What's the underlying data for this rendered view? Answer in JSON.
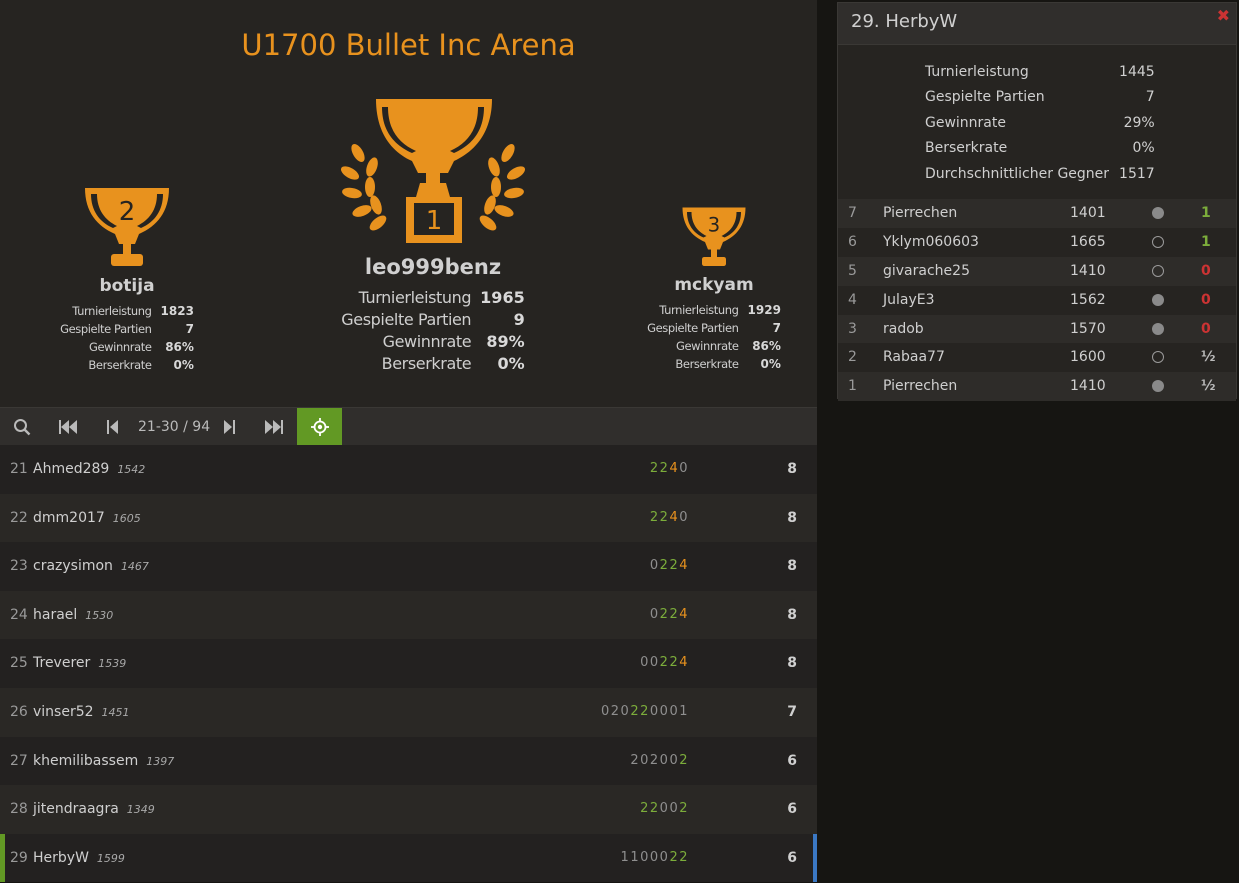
{
  "tournament": {
    "title": "U1700 Bullet Inc Arena",
    "podium": {
      "first": {
        "name": "leo999benz",
        "rank": "1",
        "performance": "1965",
        "games": "9",
        "win_rate": "89%",
        "berserk_rate": "0%"
      },
      "second": {
        "name": "botija",
        "rank": "2",
        "performance": "1823",
        "games": "7",
        "win_rate": "86%",
        "berserk_rate": "0%"
      },
      "third": {
        "name": "mckyam",
        "rank": "3",
        "performance": "1929",
        "games": "7",
        "win_rate": "86%",
        "berserk_rate": "0%"
      }
    },
    "labels": {
      "performance": "Turnierleistung",
      "games": "Gespielte Partien",
      "win_rate": "Gewinnrate",
      "berserk_rate": "Berserkrate",
      "avg_opponent": "Durchschnittlicher Gegner"
    },
    "pager": {
      "status": "21-30 / 94"
    },
    "standings": [
      {
        "rank": "21",
        "name": "Ahmed289",
        "rating": "1542",
        "sheet": [
          [
            "2",
            "g"
          ],
          [
            "2",
            "g"
          ],
          [
            "4",
            "o"
          ],
          [
            "0",
            "n"
          ]
        ],
        "total": "8"
      },
      {
        "rank": "22",
        "name": "dmm2017",
        "rating": "1605",
        "sheet": [
          [
            "2",
            "g"
          ],
          [
            "2",
            "g"
          ],
          [
            "4",
            "o"
          ],
          [
            "0",
            "n"
          ]
        ],
        "total": "8"
      },
      {
        "rank": "23",
        "name": "crazysimon",
        "rating": "1467",
        "sheet": [
          [
            "0",
            "n"
          ],
          [
            "2",
            "g"
          ],
          [
            "2",
            "g"
          ],
          [
            "4",
            "o"
          ]
        ],
        "total": "8"
      },
      {
        "rank": "24",
        "name": "harael",
        "rating": "1530",
        "sheet": [
          [
            "0",
            "n"
          ],
          [
            "2",
            "g"
          ],
          [
            "2",
            "g"
          ],
          [
            "4",
            "o"
          ]
        ],
        "total": "8"
      },
      {
        "rank": "25",
        "name": "Treverer",
        "rating": "1539",
        "sheet": [
          [
            "0",
            "n"
          ],
          [
            "0",
            "n"
          ],
          [
            "2",
            "g"
          ],
          [
            "2",
            "g"
          ],
          [
            "4",
            "o"
          ]
        ],
        "total": "8"
      },
      {
        "rank": "26",
        "name": "vinser52",
        "rating": "1451",
        "sheet": [
          [
            "0",
            "n"
          ],
          [
            "2",
            "n"
          ],
          [
            "0",
            "n"
          ],
          [
            "2",
            "g"
          ],
          [
            "2",
            "g"
          ],
          [
            "0",
            "n"
          ],
          [
            "0",
            "n"
          ],
          [
            "0",
            "n"
          ],
          [
            "1",
            "n"
          ]
        ],
        "total": "7"
      },
      {
        "rank": "27",
        "name": "khemilibassem",
        "rating": "1397",
        "sheet": [
          [
            "2",
            "n"
          ],
          [
            "0",
            "n"
          ],
          [
            "2",
            "n"
          ],
          [
            "0",
            "n"
          ],
          [
            "0",
            "n"
          ],
          [
            "2",
            "g"
          ]
        ],
        "total": "6"
      },
      {
        "rank": "28",
        "name": "jitendraagra",
        "rating": "1349",
        "sheet": [
          [
            "2",
            "g"
          ],
          [
            "2",
            "g"
          ],
          [
            "0",
            "n"
          ],
          [
            "0",
            "n"
          ],
          [
            "2",
            "g"
          ]
        ],
        "total": "6"
      },
      {
        "rank": "29",
        "name": "HerbyW",
        "rating": "1599",
        "sheet": [
          [
            "1",
            "n"
          ],
          [
            "1",
            "n"
          ],
          [
            "0",
            "n"
          ],
          [
            "0",
            "n"
          ],
          [
            "0",
            "n"
          ],
          [
            "2",
            "g"
          ],
          [
            "2",
            "g"
          ]
        ],
        "total": "6"
      }
    ]
  },
  "player_panel": {
    "title": "29. HerbyW",
    "stats": {
      "performance": "1445",
      "games": "7",
      "win_rate": "29%",
      "berserk_rate": "0%",
      "avg_opponent": "1517"
    },
    "games": [
      {
        "round": "7",
        "opponent": "Pierrechen",
        "rating": "1401",
        "color": "white",
        "result": "1",
        "result_type": "win"
      },
      {
        "round": "6",
        "opponent": "Yklym060603",
        "rating": "1665",
        "color": "black",
        "result": "1",
        "result_type": "win"
      },
      {
        "round": "5",
        "opponent": "givarache25",
        "rating": "1410",
        "color": "black",
        "result": "0",
        "result_type": "loss"
      },
      {
        "round": "4",
        "opponent": "JulayE3",
        "rating": "1562",
        "color": "white",
        "result": "0",
        "result_type": "loss"
      },
      {
        "round": "3",
        "opponent": "radob",
        "rating": "1570",
        "color": "white",
        "result": "0",
        "result_type": "loss"
      },
      {
        "round": "2",
        "opponent": "Rabaa77",
        "rating": "1600",
        "color": "black",
        "result": "½",
        "result_type": "draw"
      },
      {
        "round": "1",
        "opponent": "Pierrechen",
        "rating": "1410",
        "color": "white",
        "result": "½",
        "result_type": "draw"
      }
    ]
  },
  "colors": {
    "accent": "#e8921e",
    "win": "#7cad3b",
    "loss": "#cc3333",
    "focus": "#629924",
    "highlight": "#3b78c4"
  }
}
